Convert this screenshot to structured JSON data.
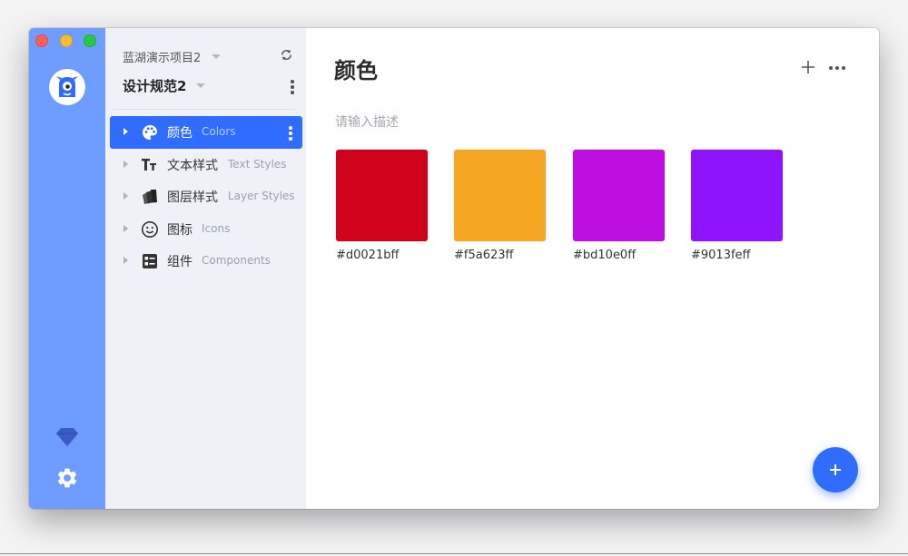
{
  "sidebar": {
    "project_name": "蓝湖演示项目2",
    "spec_name": "设计规范2",
    "items": [
      {
        "label_zh": "颜色",
        "label_en": "Colors",
        "icon": "palette-icon",
        "active": true
      },
      {
        "label_zh": "文本样式",
        "label_en": "Text Styles",
        "icon": "text-style-icon",
        "active": false
      },
      {
        "label_zh": "图层样式",
        "label_en": "Layer Styles",
        "icon": "layer-style-icon",
        "active": false
      },
      {
        "label_zh": "图标",
        "label_en": "Icons",
        "icon": "smiley-icon",
        "active": false
      },
      {
        "label_zh": "组件",
        "label_en": "Components",
        "icon": "component-icon",
        "active": false
      }
    ]
  },
  "rail": {
    "icons": [
      "app-logo-icon",
      "sketch-diamond-icon",
      "settings-gear-icon"
    ]
  },
  "main": {
    "title": "颜色",
    "description_placeholder": "请输入描述",
    "swatches": [
      {
        "hex_label": "#d0021bff",
        "color": "#d0021b"
      },
      {
        "hex_label": "#f5a623ff",
        "color": "#f5a623"
      },
      {
        "hex_label": "#bd10e0ff",
        "color": "#bd10e0"
      },
      {
        "hex_label": "#9013feff",
        "color": "#9013fe"
      }
    ]
  },
  "colors": {
    "rail": "#6f9cff",
    "sidebar": "#eef1f8",
    "accent": "#2f6cff"
  }
}
